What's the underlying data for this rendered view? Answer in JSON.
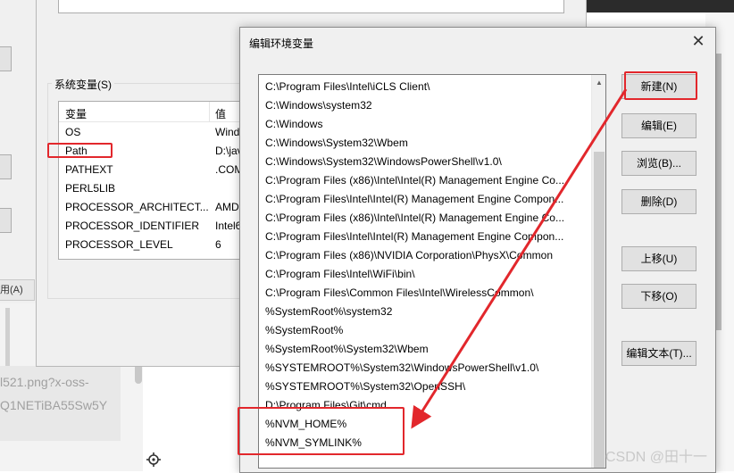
{
  "background": {
    "left_tab_label": "用(A)",
    "url_lines": [
      "l521.png?x-oss-",
      "Q1NETiBA55Sw5Y"
    ]
  },
  "sys_vars": {
    "group_label": "系统变量(S)",
    "col_var": "变量",
    "col_val": "值",
    "rows": [
      {
        "name": "OS",
        "value": "Wind"
      },
      {
        "name": "Path",
        "value": "D:\\jav"
      },
      {
        "name": "PATHEXT",
        "value": ".COM"
      },
      {
        "name": "PERL5LIB",
        "value": ""
      },
      {
        "name": "PROCESSOR_ARCHITECT...",
        "value": "AMD"
      },
      {
        "name": "PROCESSOR_IDENTIFIER",
        "value": "Intel6"
      },
      {
        "name": "PROCESSOR_LEVEL",
        "value": "6"
      }
    ]
  },
  "dialog": {
    "title": "编辑环境变量",
    "close_glyph": "✕",
    "entries": [
      "C:\\Program Files\\Intel\\iCLS Client\\",
      "C:\\Windows\\system32",
      "C:\\Windows",
      "C:\\Windows\\System32\\Wbem",
      "C:\\Windows\\System32\\WindowsPowerShell\\v1.0\\",
      "C:\\Program Files (x86)\\Intel\\Intel(R) Management Engine Co...",
      "C:\\Program Files\\Intel\\Intel(R) Management Engine Compon...",
      "C:\\Program Files (x86)\\Intel\\Intel(R) Management Engine Co...",
      "C:\\Program Files\\Intel\\Intel(R) Management Engine Compon...",
      "C:\\Program Files (x86)\\NVIDIA Corporation\\PhysX\\Common",
      "C:\\Program Files\\Intel\\WiFi\\bin\\",
      "C:\\Program Files\\Common Files\\Intel\\WirelessCommon\\",
      "%SystemRoot%\\system32",
      "%SystemRoot%",
      "%SystemRoot%\\System32\\Wbem",
      "%SYSTEMROOT%\\System32\\WindowsPowerShell\\v1.0\\",
      "%SYSTEMROOT%\\System32\\OpenSSH\\",
      "D:\\Program Files\\Git\\cmd",
      "%NVM_HOME%",
      "%NVM_SYMLINK%"
    ],
    "buttons": {
      "new": "新建(N)",
      "edit": "编辑(E)",
      "browse": "浏览(B)...",
      "delete": "删除(D)",
      "move_up": "上移(U)",
      "move_down": "下移(O)",
      "edit_text": "编辑文本(T)..."
    }
  },
  "annotation_color": "#e2272c",
  "watermark": "CSDN @田十一"
}
